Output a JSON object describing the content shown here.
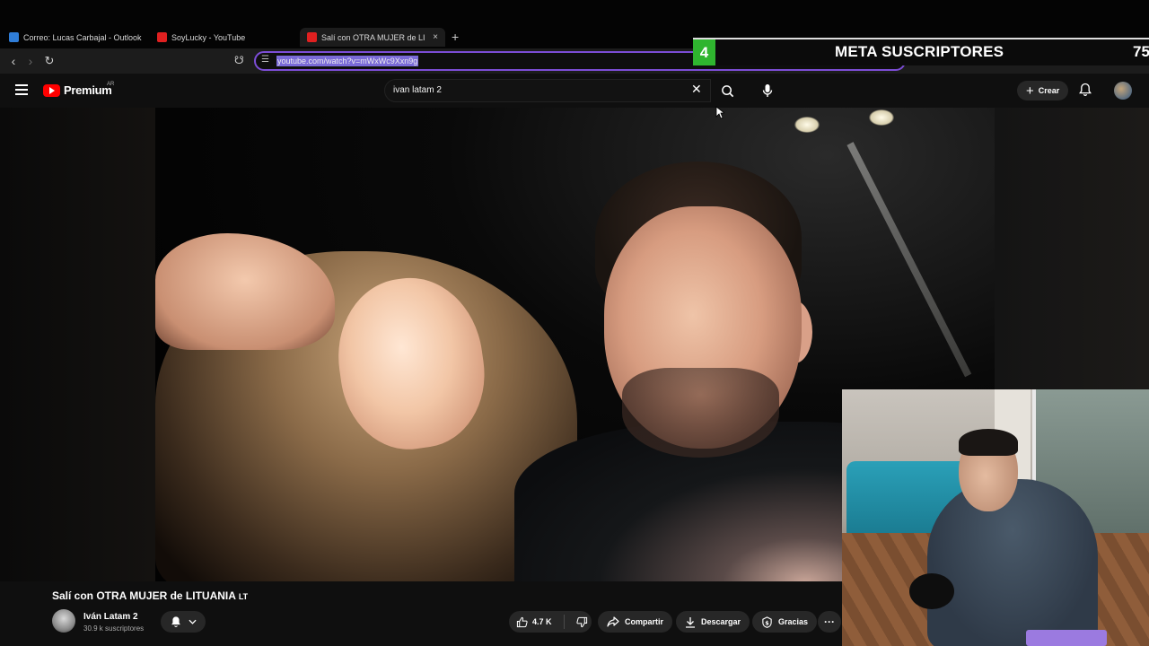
{
  "browser": {
    "tabs": [
      {
        "label": "Correo: Lucas Carbajal - Outlook",
        "color": "#2f7dd8"
      },
      {
        "label": "SoyLucky - YouTube",
        "color": "#e02020"
      },
      {
        "label": "Salí con OTRA MUJER de LITUAN",
        "color": "#e02020",
        "active": true
      }
    ],
    "new_tab": "+",
    "close_tab": "×",
    "url": "youtube.com/watch?v=mWxWc9Xxn9g"
  },
  "overlay": {
    "number": "4",
    "title": "META SUSCRIPTORES",
    "count": "75"
  },
  "youtube": {
    "brand": "Premium",
    "region": "AR",
    "search_query": "ivan latam 2",
    "create_label": "Crear"
  },
  "video": {
    "title": "Salí con OTRA MUJER de LITUANIA",
    "title_flag": "LT",
    "channel_name": "Iván Latam 2",
    "subscribers": "30.9 k suscriptores",
    "likes": "4.7 K",
    "share_label": "Compartir",
    "download_label": "Descargar",
    "thanks_label": "Gracias",
    "more_label": "···"
  },
  "colors": {
    "accent": "#7c4dd6",
    "youtube_red": "#ff0000",
    "meta_green": "#2fb52f"
  }
}
